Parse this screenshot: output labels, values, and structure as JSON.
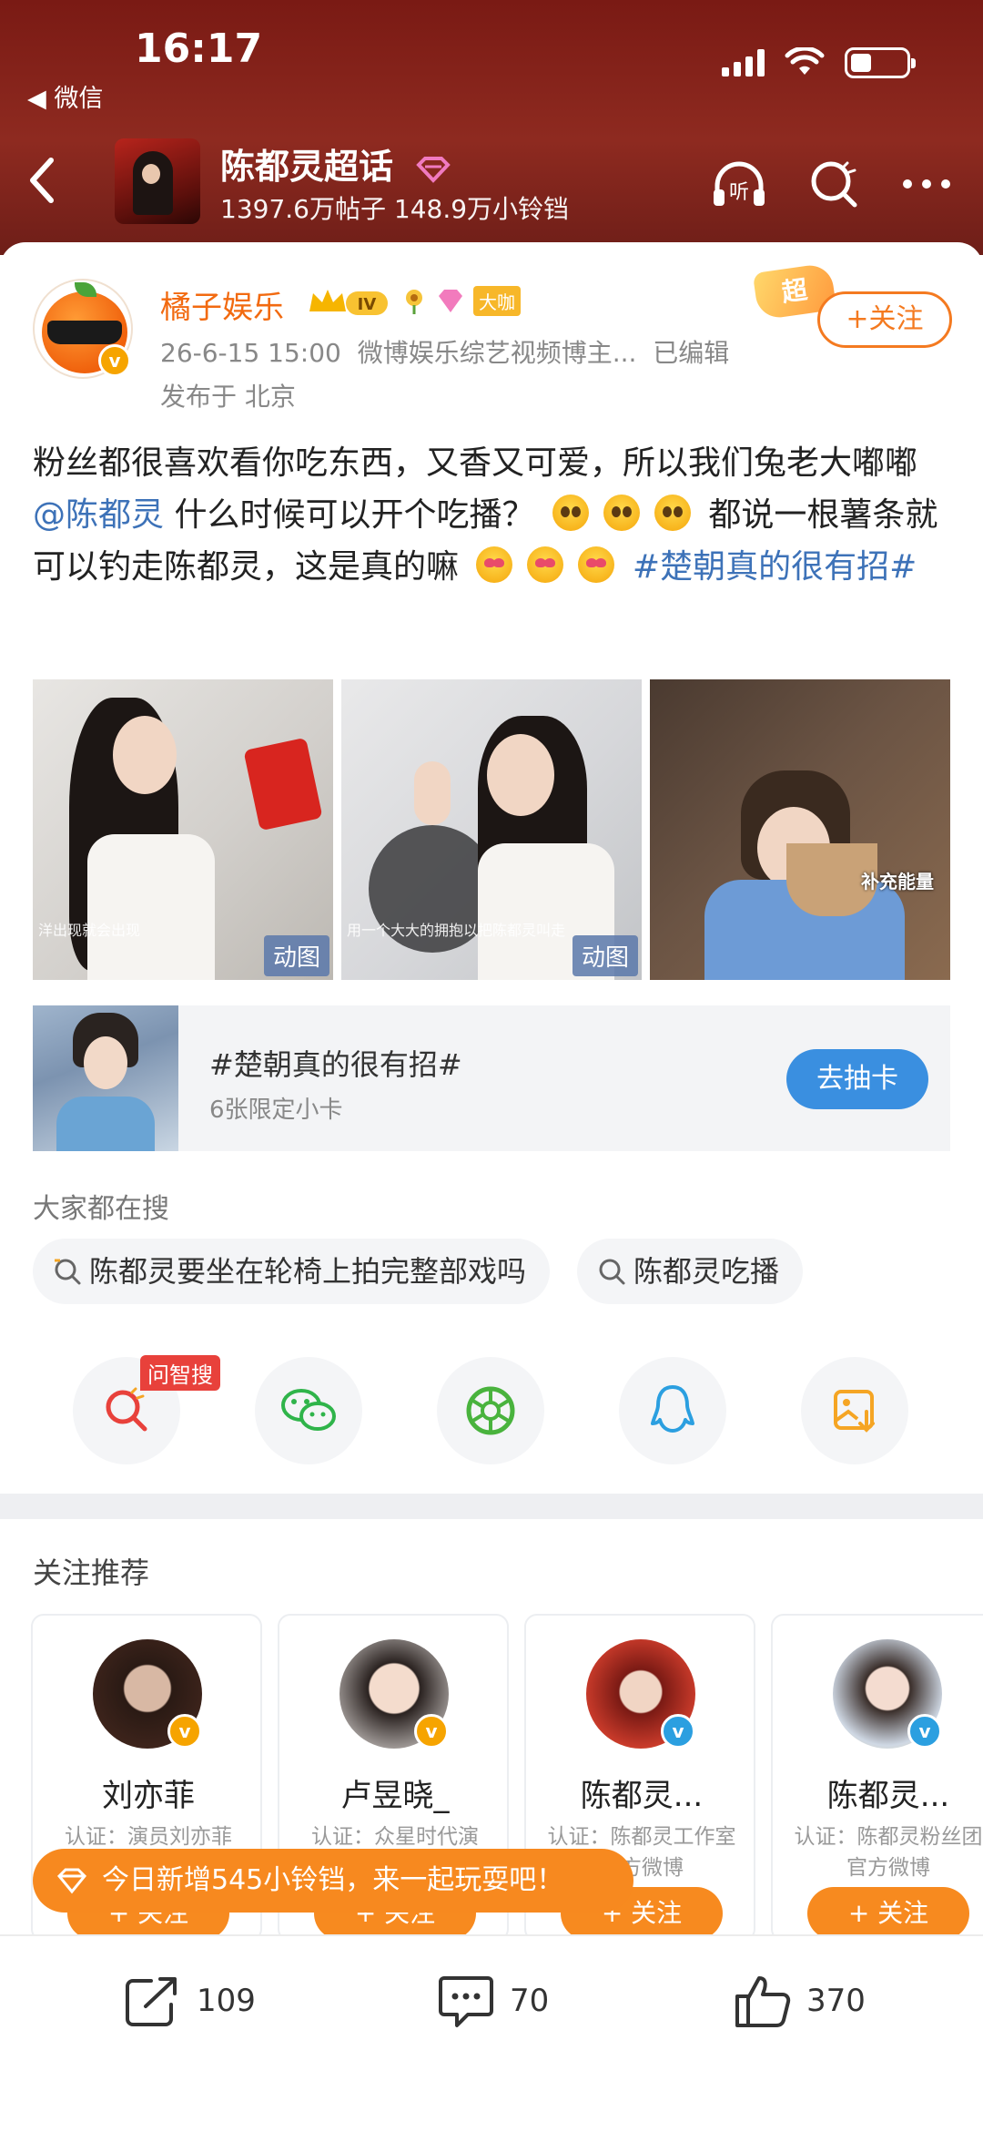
{
  "status_bar": {
    "time": "16:17",
    "back_app": "◀ 微信"
  },
  "topic": {
    "title": "陈都灵超话",
    "posts": "1397.6万帖子",
    "followers": "148.9万小铃铛",
    "listen_label": "听"
  },
  "post": {
    "author": "橘子娱乐",
    "level": "IV",
    "badge_text": "大咖",
    "chao_tag": "超",
    "date": "26-6-15 15:00",
    "source": "微博娱乐综艺视频博主...",
    "edited": "已编辑",
    "location": "发布于 北京",
    "follow_label": "+关注",
    "text_1": "粉丝都很喜欢看你吃东西，又香又可爱，所以我们兔老大嘟嘟",
    "mention": "@陈都灵",
    "text_2": " 什么时候可以开个吃播？",
    "text_3": "都说一根薯条就可以钓走陈都灵，这是真的嘛",
    "hashtag": "#楚朝真的很有招#",
    "images": [
      {
        "tag": "动图",
        "caption": "洋出现就会出现"
      },
      {
        "tag": "动图",
        "caption": "用一个大大的拥抱以把陈都灵叫走"
      },
      {
        "caption": "补充能量"
      }
    ]
  },
  "promo": {
    "title": "#楚朝真的很有招#",
    "subtitle": "6张限定小卡",
    "button": "去抽卡"
  },
  "search": {
    "heading": "大家都在搜",
    "chips": [
      "陈都灵要坐在轮椅上拍完整部戏吗",
      "陈都灵吃播"
    ]
  },
  "share": {
    "badge": "问智搜",
    "icons": [
      "search-ai-icon",
      "wechat-icon",
      "moments-icon",
      "qq-icon",
      "save-image-icon"
    ]
  },
  "recommend": {
    "heading": "关注推荐",
    "follow_label": "+ 关注",
    "cards": [
      {
        "name": "刘亦菲",
        "desc": "认证：演员刘亦菲"
      },
      {
        "name": "卢昱晓_",
        "desc": "认证：众星时代演"
      },
      {
        "name": "陈都灵...",
        "desc": "认证：陈都灵工作室官方微博"
      },
      {
        "name": "陈都灵...",
        "desc": "认证：陈都灵粉丝团官方微博"
      }
    ]
  },
  "toast": {
    "text": "今日新增545小铃铛，来一起玩耍吧！"
  },
  "bottom_bar": {
    "reposts": "109",
    "comments": "70",
    "likes": "370"
  },
  "colors": {
    "header": "#8e2a20",
    "accent": "#f47a20",
    "link": "#3d72b8",
    "button_blue": "#3a8fe0"
  }
}
